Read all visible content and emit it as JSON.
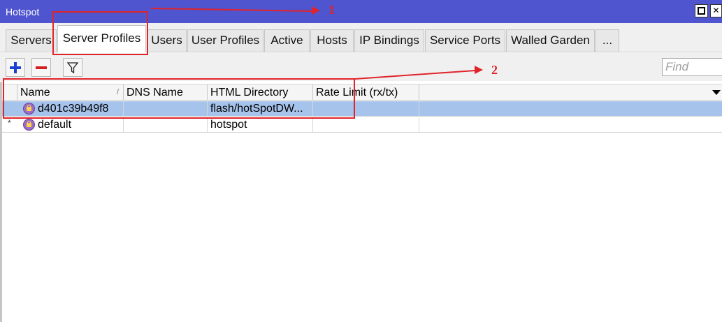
{
  "window": {
    "title": "Hotspot"
  },
  "tabs": [
    {
      "label": "Servers"
    },
    {
      "label": "Server Profiles"
    },
    {
      "label": "Users"
    },
    {
      "label": "User Profiles"
    },
    {
      "label": "Active"
    },
    {
      "label": "Hosts"
    },
    {
      "label": "IP Bindings"
    },
    {
      "label": "Service Ports"
    },
    {
      "label": "Walled Garden"
    },
    {
      "label": "..."
    }
  ],
  "active_tab": "Server Profiles",
  "toolbar": {
    "add_icon": "plus-icon",
    "remove_icon": "minus-icon",
    "filter_icon": "filter-icon",
    "find_placeholder": "Find"
  },
  "table": {
    "columns": [
      "Name",
      "DNS Name",
      "HTML Directory",
      "Rate Limit (rx/tx)"
    ],
    "sort_indicator": "/",
    "rows": [
      {
        "marker": "",
        "name": "d401c39b49f8",
        "dns_name": "",
        "html_directory": "flash/hotSpotDW...",
        "rate_limit": "",
        "selected": true
      },
      {
        "marker": "*",
        "name": "default",
        "dns_name": "",
        "html_directory": "hotspot",
        "rate_limit": "",
        "selected": false
      }
    ]
  },
  "annotations": [
    {
      "label": "1",
      "color": "#e0242a"
    },
    {
      "label": "2",
      "color": "#e0242a"
    }
  ],
  "colors": {
    "titlebar": "#4f54cf",
    "selected_row": "#a6c3ec",
    "annotation": "#e0242a",
    "add_icon": "#1a3fd1",
    "remove_icon": "#d41f1f"
  }
}
